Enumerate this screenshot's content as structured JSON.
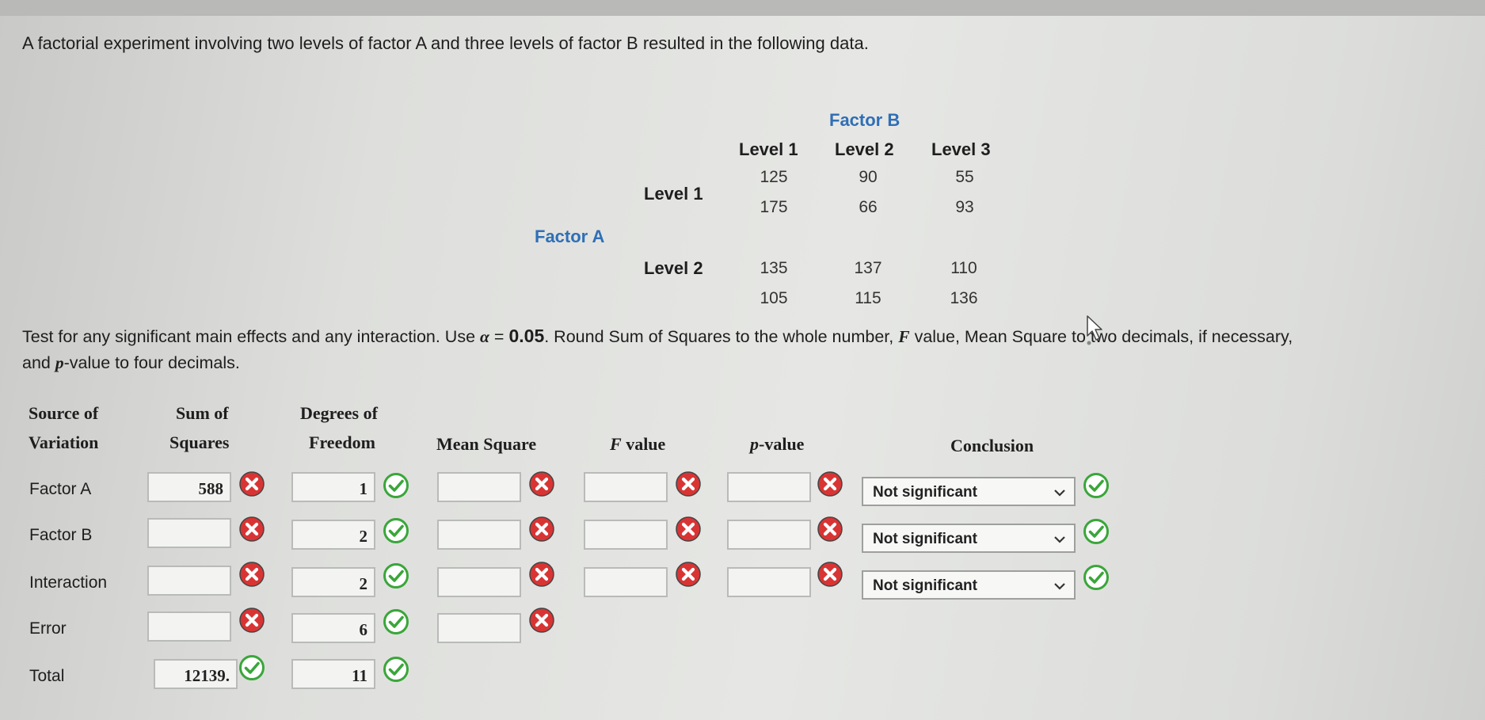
{
  "intro": "A factorial experiment involving two levels of factor A and three levels of factor B resulted in the following data.",
  "data_table": {
    "factor_b_label": "Factor B",
    "factor_a_label": "Factor A",
    "col_headers": [
      "Level 1",
      "Level 2",
      "Level 3"
    ],
    "row_headers": [
      "Level 1",
      "Level 2"
    ],
    "cells": [
      [
        "125",
        "175",
        "90",
        "66",
        "55",
        "93"
      ],
      [
        "135",
        "105",
        "137",
        "115",
        "110",
        "136"
      ]
    ]
  },
  "instructions": {
    "part1": "Test for any significant main effects and any interaction. Use",
    "alpha_symbol": "α",
    "equals": "=",
    "alpha_value": "0.05",
    "part2": ". Round Sum of Squares to the whole number,",
    "f_symbol": "F",
    "part3": "value, Mean Square to two decimals, if necessary,",
    "line2_a": "and",
    "p_symbol": "p",
    "line2_b": "-value to four decimals."
  },
  "anova": {
    "headers": {
      "source_1": "Source of",
      "source_2": "Variation",
      "ss_1": "Sum of",
      "ss_2": "Squares",
      "df_1": "Degrees of",
      "df_2": "Freedom",
      "ms": "Mean Square",
      "f": "F",
      "f_suffix": " value",
      "p": "p",
      "p_suffix": "-value",
      "conclusion": "Conclusion"
    },
    "rows": [
      {
        "source": "Factor A",
        "ss": "588",
        "ss_status": "wrong",
        "df": "1",
        "df_status": "correct",
        "ms": "",
        "ms_status": "wrong",
        "f": "",
        "f_status": "wrong",
        "p": "",
        "p_status": "wrong",
        "conclusion": "Not significant",
        "conclusion_status": "correct"
      },
      {
        "source": "Factor B",
        "ss": "",
        "ss_status": "wrong",
        "df": "2",
        "df_status": "correct",
        "ms": "",
        "ms_status": "wrong",
        "f": "",
        "f_status": "wrong",
        "p": "",
        "p_status": "wrong",
        "conclusion": "Not significant",
        "conclusion_status": "correct"
      },
      {
        "source": "Interaction",
        "ss": "",
        "ss_status": "wrong",
        "df": "2",
        "df_status": "correct",
        "ms": "",
        "ms_status": "wrong",
        "f": "",
        "f_status": "wrong",
        "p": "",
        "p_status": "wrong",
        "conclusion": "Not significant",
        "conclusion_status": "correct"
      },
      {
        "source": "Error",
        "ss": "",
        "ss_status": "wrong",
        "df": "6",
        "df_status": "correct",
        "ms": "",
        "ms_status": "wrong"
      },
      {
        "source": "Total",
        "ss": "12139.",
        "ss_status": "correct",
        "df": "11",
        "df_status": "correct"
      }
    ]
  },
  "colors": {
    "blue_label": "#2f6fb6",
    "correct": "#3aa63a",
    "wrong": "#d93434"
  },
  "icons": {
    "correct": "check-circle-icon",
    "wrong": "x-circle-icon",
    "dropdown": "chevron-down-icon",
    "cursor": "mouse-pointer-icon"
  }
}
